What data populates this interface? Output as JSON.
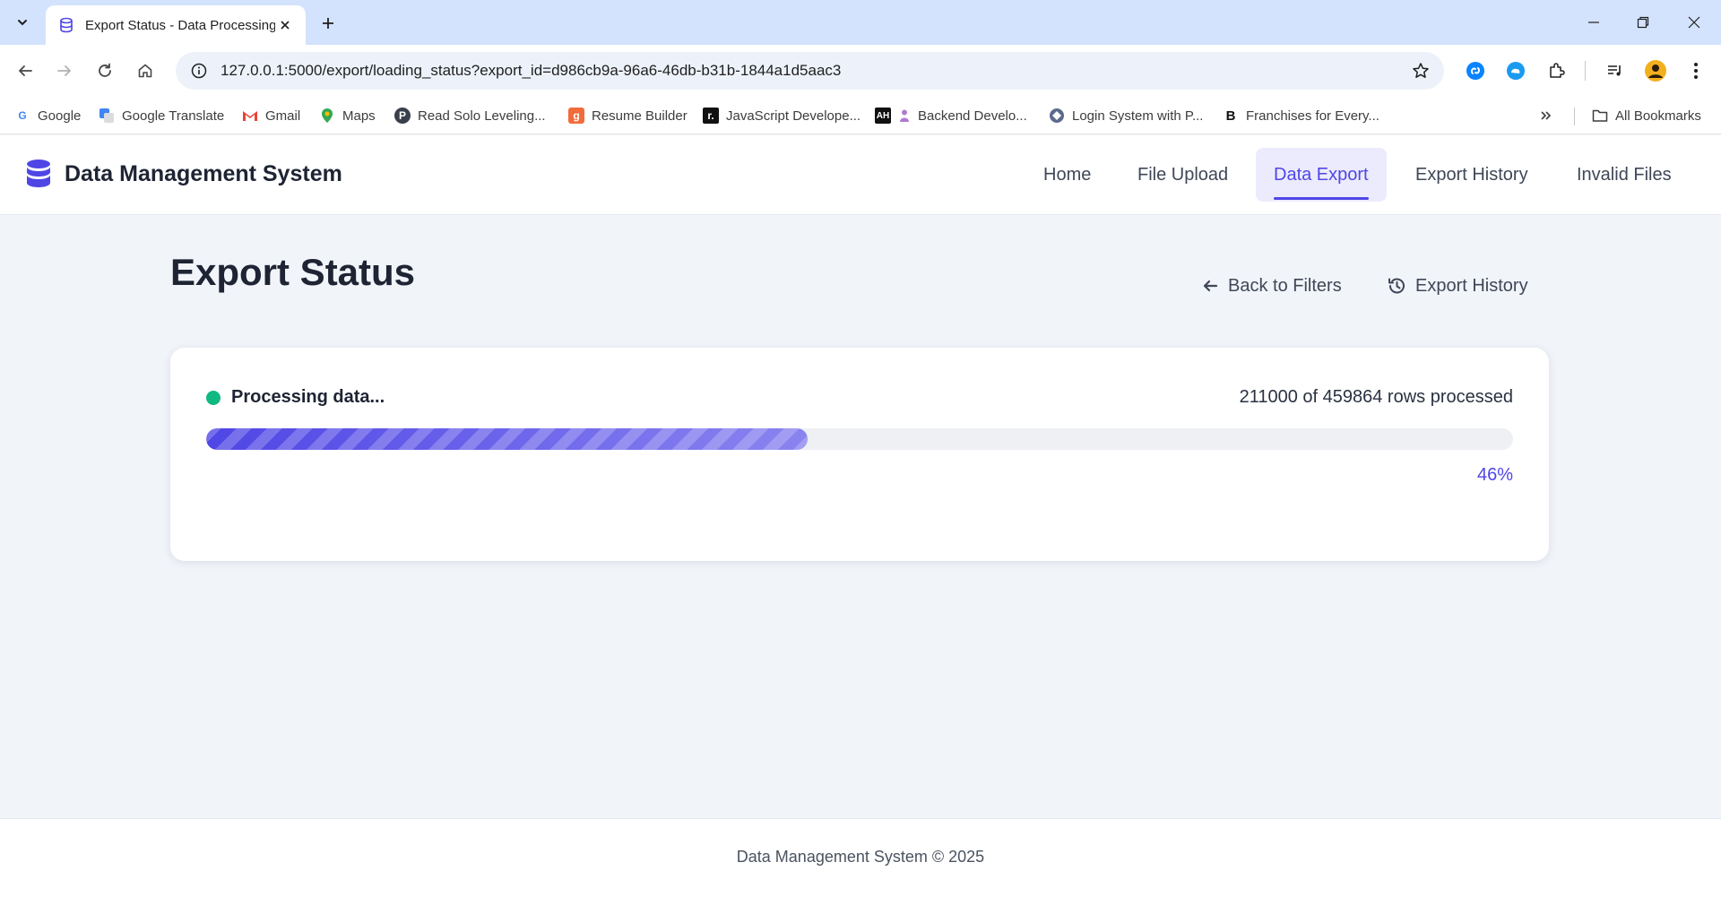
{
  "browser": {
    "tab_title": "Export Status - Data Processing",
    "url": "127.0.0.1:5000/export/loading_status?export_id=d986cb9a-96a6-46db-b31b-1844a1d5aac3",
    "bookmarks": [
      {
        "label": "Google",
        "icon": "google-icon"
      },
      {
        "label": "Google Translate",
        "icon": "translate-icon"
      },
      {
        "label": "Gmail",
        "icon": "gmail-icon"
      },
      {
        "label": "Maps",
        "icon": "maps-icon"
      },
      {
        "label": "Read Solo Leveling...",
        "icon": "p-icon"
      },
      {
        "label": "Resume Builder",
        "icon": "resume-icon"
      },
      {
        "label": "JavaScript Develope...",
        "icon": "r-icon"
      },
      {
        "label": "Backend Develo...",
        "icon": "ah-icon"
      },
      {
        "label": "Login System with P...",
        "icon": "diamond-icon"
      },
      {
        "label": "Franchises for Every...",
        "icon": "b-icon"
      }
    ],
    "all_bookmarks": "All Bookmarks"
  },
  "app": {
    "brand": "Data Management System",
    "nav": [
      {
        "label": "Home",
        "active": false
      },
      {
        "label": "File Upload",
        "active": false
      },
      {
        "label": "Data Export",
        "active": true
      },
      {
        "label": "Export History",
        "active": false
      },
      {
        "label": "Invalid Files",
        "active": false
      }
    ],
    "accent_color": "#4f46e5",
    "status_color": "#10b981"
  },
  "page": {
    "title": "Export Status",
    "back_link": "Back to Filters",
    "history_link": "Export History"
  },
  "progress": {
    "status": "Processing data...",
    "rows_text": "211000 of 459864 rows processed",
    "rows_processed": 211000,
    "rows_total": 459864,
    "percent": 46,
    "percent_text": "46%"
  },
  "footer": {
    "text": "Data Management System © 2025"
  }
}
